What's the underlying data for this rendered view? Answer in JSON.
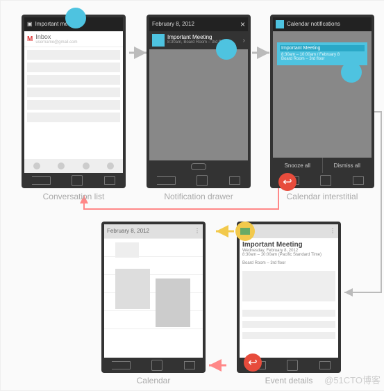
{
  "phone1": {
    "title_bar": "Important meeting",
    "inbox_label": "Inbox",
    "account": "username@gmail.com"
  },
  "phone2": {
    "date": "February 8, 2012",
    "close": "×",
    "notif_title": "Important Meeting",
    "notif_sub": "8:30am, Board Room – 3rd floor"
  },
  "phone3": {
    "header": "Calendar notifications",
    "notif_title": "Important Meeting",
    "notif_sub": "8:30am – 10:00am / February 8\nBoard Room – 3rd floor",
    "snooze": "Snooze all",
    "dismiss": "Dismiss all"
  },
  "phone4": {
    "date": "February 8, 2012"
  },
  "phone5": {
    "event_title": "Important Meeting",
    "event_date": "Wednesday, February 8, 2012",
    "event_time": "8:30am – 10:00am (Pacific Standard Time)",
    "event_loc": "Board Room – 3rd floor"
  },
  "labels": {
    "l1": "Conversation list",
    "l2": "Notification drawer",
    "l3": "Calendar interstitial",
    "l4": "Calendar",
    "l5": "Event details"
  },
  "badge_back": "↩",
  "watermark": "@51CTO博客"
}
